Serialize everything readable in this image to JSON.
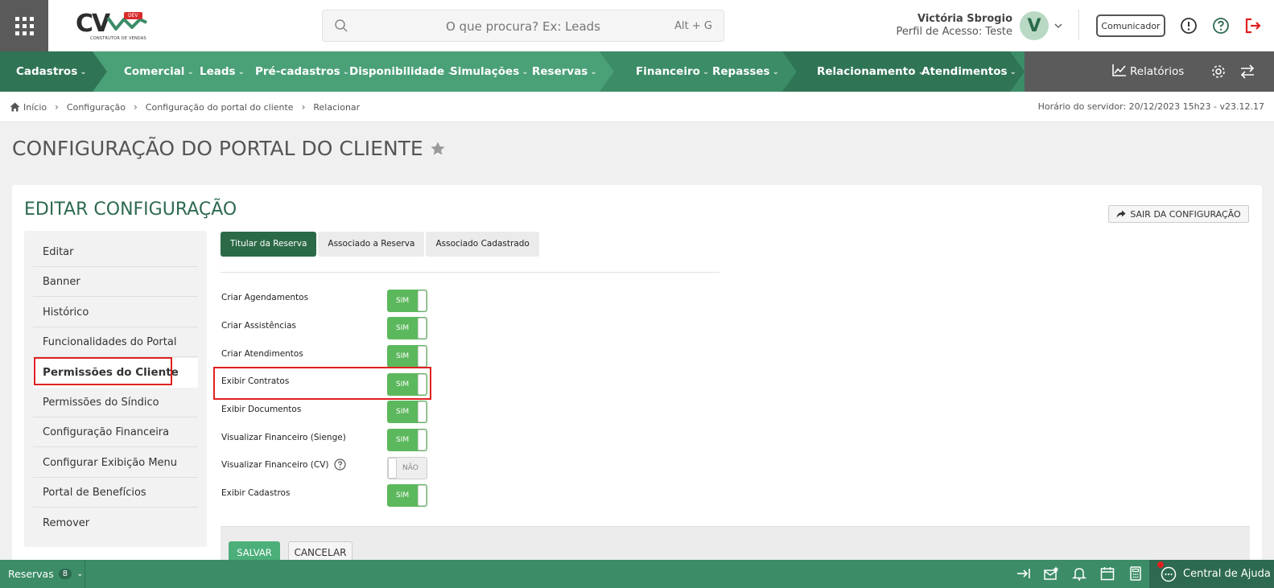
{
  "header": {
    "logo_text": "CV",
    "logo_badge": "DEV",
    "logo_subtitle": "CONSTRUTOR DE VENDAS",
    "search_placeholder": "O que procura? Ex: Leads",
    "search_shortcut": "Alt + G",
    "user_name": "Victória Sbrogio",
    "user_profile": "Perfil de Acesso: Teste",
    "avatar_initial": "V",
    "comunicador_label": "Comunicador"
  },
  "nav": {
    "items": [
      {
        "label": "Cadastros"
      },
      {
        "label": "Comercial"
      },
      {
        "label": "Leads"
      },
      {
        "label": "Pré-cadastros"
      },
      {
        "label": "Disponibilidade"
      },
      {
        "label": "Simulações"
      },
      {
        "label": "Reservas"
      },
      {
        "label": "Financeiro"
      },
      {
        "label": "Repasses"
      },
      {
        "label": "Relacionamento"
      },
      {
        "label": "Atendimentos"
      }
    ],
    "reports_label": "Relatórios",
    "colors": {
      "dark": "#2f7455",
      "mid": "#3b8c67",
      "light": "#4aa077",
      "gray": "#5b5b5b"
    }
  },
  "breadcrumb": {
    "items": [
      "Início",
      "Configuração",
      "Configuração do portal do cliente",
      "Relacionar"
    ],
    "server_time": "Horário do servidor: 20/12/2023 15h23 - v23.12.17"
  },
  "page": {
    "title": "CONFIGURAÇÃO DO PORTAL DO CLIENTE",
    "card_title": "EDITAR CONFIGURAÇÃO",
    "exit_label": "SAIR DA CONFIGURAÇÃO"
  },
  "sidebar": {
    "items": [
      {
        "label": "Editar"
      },
      {
        "label": "Banner"
      },
      {
        "label": "Histórico"
      },
      {
        "label": "Funcionalidades do Portal"
      },
      {
        "label": "Permissões do Cliente"
      },
      {
        "label": "Permissões do Síndico"
      },
      {
        "label": "Configuração Financeira"
      },
      {
        "label": "Configurar Exibição Menu"
      },
      {
        "label": "Portal de Benefícios"
      },
      {
        "label": "Remover"
      }
    ],
    "active": "Permissões do Cliente"
  },
  "tabs": [
    {
      "label": "Titular da Reserva"
    },
    {
      "label": "Associado a Reserva"
    },
    {
      "label": "Associado Cadastrado"
    }
  ],
  "permissions": [
    {
      "label": "Criar Agendamentos",
      "value": "SIM",
      "on": true
    },
    {
      "label": "Criar Assistências",
      "value": "SIM",
      "on": true
    },
    {
      "label": "Criar Atendimentos",
      "value": "SIM",
      "on": true
    },
    {
      "label": "Exibir Contratos",
      "value": "SIM",
      "on": true
    },
    {
      "label": "Exibir Documentos",
      "value": "SIM",
      "on": true
    },
    {
      "label": "Visualizar Financeiro (Sienge)",
      "value": "SIM",
      "on": true
    },
    {
      "label": "Visualizar Financeiro (CV)",
      "value": "NÃO",
      "on": false
    },
    {
      "label": "Exibir Cadastros",
      "value": "SIM",
      "on": true
    }
  ],
  "actions": {
    "save_label": "SALVAR",
    "cancel_label": "CANCELAR"
  },
  "footer": {
    "reservas_label": "Reservas",
    "reservas_count": "8",
    "help_label": "Central de Ajuda"
  }
}
